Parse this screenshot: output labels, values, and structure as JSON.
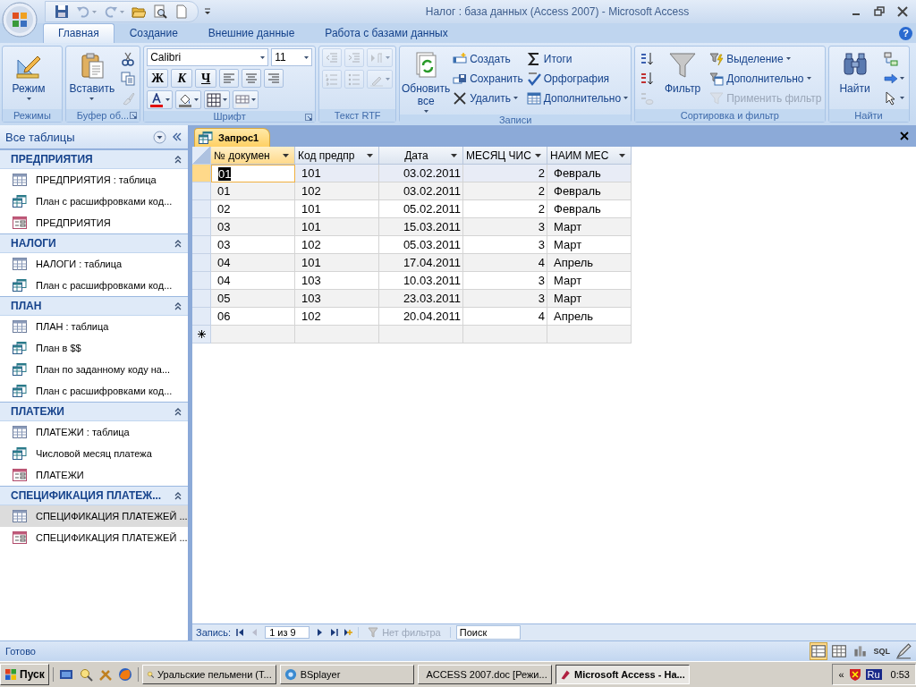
{
  "window": {
    "title": "Налог : база данных (Access 2007) - Microsoft Access",
    "help": "?"
  },
  "quick_access": [
    {
      "disabled": false,
      "dropdown": false
    },
    {
      "disabled": true,
      "dropdown": true
    },
    {
      "disabled": true,
      "dropdown": true
    },
    {
      "disabled": false,
      "dropdown": false
    },
    {
      "disabled": false,
      "dropdown": false
    },
    {
      "disabled": false,
      "dropdown": false
    }
  ],
  "ribbon_tabs": [
    {
      "label": "Главная",
      "selected": true
    },
    {
      "label": "Создание",
      "selected": false
    },
    {
      "label": "Внешние данные",
      "selected": false
    },
    {
      "label": "Работа с базами данных",
      "selected": false
    }
  ],
  "ribbon_groups": [
    {
      "label": "Режимы",
      "launcher": false,
      "blocks": [
        {
          "kind": "large",
          "label": "Режим",
          "dropdown": true
        }
      ]
    },
    {
      "label": "Буфер об...",
      "launcher": true,
      "blocks": [
        {
          "kind": "large",
          "label": "Вставить",
          "dropdown": true
        },
        {
          "kind": "stack",
          "items": [
            {
              "kind": "icon",
              "disabled": false
            },
            {
              "kind": "icon",
              "disabled": false
            },
            {
              "kind": "icon",
              "disabled": true
            }
          ]
        }
      ]
    },
    {
      "label": "Шрифт",
      "launcher": true,
      "blocks": [
        {
          "kind": "rows",
          "rows": [
            [
              {
                "kind": "field",
                "value": "Calibri"
              },
              {
                "kind": "field",
                "value": "11"
              }
            ],
            [
              {
                "kind": "letter",
                "label": "Ж"
              },
              {
                "kind": "letter",
                "label": "К"
              },
              {
                "kind": "letter",
                "label": "Ч"
              },
              {
                "kind": "icon",
                "disabled": false
              },
              {
                "kind": "icon",
                "disabled": false
              },
              {
                "kind": "icon",
                "disabled": false
              }
            ],
            [
              {
                "kind": "icon",
                "dropdown": true,
                "disabled": false
              },
              {
                "kind": "icon",
                "dropdown": true,
                "disabled": false
              },
              {
                "kind": "icon",
                "dropdown": true,
                "disabled": false
              },
              {
                "kind": "icon",
                "dropdown": true,
                "disabled": false
              }
            ]
          ]
        }
      ]
    },
    {
      "label": "Текст RTF",
      "launcher": false,
      "blocks": [
        {
          "kind": "rows",
          "rows": [
            [
              {
                "kind": "icon",
                "disabled": true
              },
              {
                "kind": "icon",
                "disabled": true
              },
              {
                "kind": "icon",
                "dropdown": true,
                "disabled": true
              }
            ],
            [
              {
                "kind": "icon",
                "disabled": true
              },
              {
                "kind": "icon",
                "disabled": true
              },
              {
                "kind": "icon",
                "dropdown": true,
                "disabled": true
              }
            ]
          ]
        }
      ]
    },
    {
      "label": "Записи",
      "launcher": false,
      "blocks": [
        {
          "kind": "large",
          "label": "Обновить все",
          "dropdown": true
        },
        {
          "kind": "stack",
          "items": [
            {
              "kind": "small",
              "label": "Создать",
              "disabled": false
            },
            {
              "kind": "small",
              "label": "Сохранить",
              "disabled": false
            },
            {
              "kind": "small",
              "label": "Удалить",
              "dropdown": true,
              "disabled": false
            }
          ]
        },
        {
          "kind": "stack",
          "items": [
            {
              "kind": "small",
              "label": "Итоги",
              "disabled": false
            },
            {
              "kind": "small",
              "label": "Орфография",
              "disabled": false
            },
            {
              "kind": "small",
              "label": "Дополнительно",
              "dropdown": true,
              "disabled": false
            }
          ]
        }
      ]
    },
    {
      "label": "Сортировка и фильтр",
      "launcher": false,
      "blocks": [
        {
          "kind": "stack",
          "items": [
            {
              "kind": "icon",
              "disabled": false
            },
            {
              "kind": "icon",
              "disabled": false
            },
            {
              "kind": "icon",
              "disabled": true
            }
          ]
        },
        {
          "kind": "large",
          "label": "Фильтр",
          "dropdown": false
        },
        {
          "kind": "stack",
          "items": [
            {
              "kind": "small",
              "label": "Выделение",
              "dropdown": true,
              "disabled": false
            },
            {
              "kind": "small",
              "label": "Дополнительно",
              "dropdown": true,
              "disabled": false
            },
            {
              "kind": "small",
              "label": "Применить фильтр",
              "disabled": true
            }
          ]
        }
      ]
    },
    {
      "label": "Найти",
      "launcher": false,
      "blocks": [
        {
          "kind": "large",
          "label": "Найти",
          "dropdown": false
        },
        {
          "kind": "stack",
          "items": [
            {
              "kind": "icon",
              "disabled": false
            },
            {
              "kind": "icon",
              "dropdown": true,
              "disabled": false
            },
            {
              "kind": "icon",
              "dropdown": true,
              "disabled": false
            }
          ]
        }
      ]
    }
  ],
  "nav_pane": {
    "title": "Все таблицы",
    "groups": [
      {
        "title": "ПРЕДПРИЯТИЯ",
        "expanded": true,
        "items": [
          {
            "label": "ПРЕДПРИЯТИЯ : таблица",
            "kind": "table",
            "selected": false
          },
          {
            "label": "План с расшифровками код...",
            "kind": "query",
            "selected": false
          },
          {
            "label": "ПРЕДПРИЯТИЯ",
            "kind": "form",
            "selected": false
          }
        ]
      },
      {
        "title": "НАЛОГИ",
        "expanded": true,
        "items": [
          {
            "label": "НАЛОГИ : таблица",
            "kind": "table",
            "selected": false
          },
          {
            "label": "План с расшифровками код...",
            "kind": "query",
            "selected": false
          }
        ]
      },
      {
        "title": "ПЛАН",
        "expanded": true,
        "items": [
          {
            "label": "ПЛАН : таблица",
            "kind": "table",
            "selected": false
          },
          {
            "label": "План в $$",
            "kind": "query",
            "selected": false
          },
          {
            "label": "План по заданному коду на...",
            "kind": "query",
            "selected": false
          },
          {
            "label": "План с расшифровками код...",
            "kind": "query",
            "selected": false
          }
        ]
      },
      {
        "title": "ПЛАТЕЖИ",
        "expanded": true,
        "items": [
          {
            "label": "ПЛАТЕЖИ : таблица",
            "kind": "table",
            "selected": false
          },
          {
            "label": "Числовой месяц платежа",
            "kind": "query",
            "selected": false
          },
          {
            "label": "ПЛАТЕЖИ",
            "kind": "form",
            "selected": false
          }
        ]
      },
      {
        "title": "СПЕЦИФИКАЦИЯ ПЛАТЕЖ...",
        "expanded": true,
        "items": [
          {
            "label": "СПЕЦИФИКАЦИЯ ПЛАТЕЖЕЙ ...",
            "kind": "table",
            "selected": true
          },
          {
            "label": "СПЕЦИФИКАЦИЯ ПЛАТЕЖЕЙ ...",
            "kind": "form",
            "selected": false
          }
        ]
      }
    ]
  },
  "document_tabs": [
    {
      "label": "Запрос1",
      "selected": true
    }
  ],
  "datasheet": {
    "columns": [
      {
        "label": "№ докумен",
        "kind": "text",
        "selected": true
      },
      {
        "label": "Код предпр",
        "kind": "text",
        "selected": false
      },
      {
        "label": "Дата",
        "kind": "date",
        "selected": false
      },
      {
        "label": "МЕСЯЦ ЧИС",
        "kind": "number",
        "selected": false
      },
      {
        "label": "НАИМ МЕС",
        "kind": "text",
        "selected": false
      }
    ],
    "rows": [
      {
        "cells": [
          "01",
          "101",
          "03.02.2011",
          "2",
          "Февраль"
        ],
        "selected": true
      },
      {
        "cells": [
          "01",
          "102",
          "03.02.2011",
          "2",
          "Февраль"
        ],
        "selected": false
      },
      {
        "cells": [
          "02",
          "101",
          "05.02.2011",
          "2",
          "Февраль"
        ],
        "selected": false
      },
      {
        "cells": [
          "03",
          "101",
          "15.03.2011",
          "3",
          "Март"
        ],
        "selected": false
      },
      {
        "cells": [
          "03",
          "102",
          "05.03.2011",
          "3",
          "Март"
        ],
        "selected": false
      },
      {
        "cells": [
          "04",
          "101",
          "17.04.2011",
          "4",
          "Апрель"
        ],
        "selected": false
      },
      {
        "cells": [
          "04",
          "103",
          "10.03.2011",
          "3",
          "Март"
        ],
        "selected": false
      },
      {
        "cells": [
          "05",
          "103",
          "23.03.2011",
          "3",
          "Март"
        ],
        "selected": false
      },
      {
        "cells": [
          "06",
          "102",
          "20.04.2011",
          "4",
          "Апрель"
        ],
        "selected": false
      }
    ],
    "new_row": true
  },
  "record_nav": {
    "label": "Запись:",
    "position": "1 из 9",
    "filter": "Нет фильтра",
    "search_placeholder": "Поиск"
  },
  "status_bar": {
    "text": "Готово",
    "views": [
      {
        "kind": "datasheet",
        "selected": true
      },
      {
        "kind": "pivot_table",
        "selected": false
      },
      {
        "kind": "pivot_chart",
        "selected": false
      },
      {
        "kind": "sql",
        "label": "SQL",
        "selected": false
      },
      {
        "kind": "design",
        "selected": false
      }
    ]
  },
  "taskbar": {
    "start": "Пуск",
    "tasks": [
      {
        "label": "Уральские пельмени (Т...",
        "selected": false
      },
      {
        "label": "BSplayer",
        "selected": false
      },
      {
        "label": "ACCESS 2007.doc [Режи...",
        "selected": false
      },
      {
        "label": "Microsoft Access - На...",
        "selected": true
      }
    ],
    "tray_expand": "«",
    "language": "Ru",
    "clock": "0:53"
  }
}
